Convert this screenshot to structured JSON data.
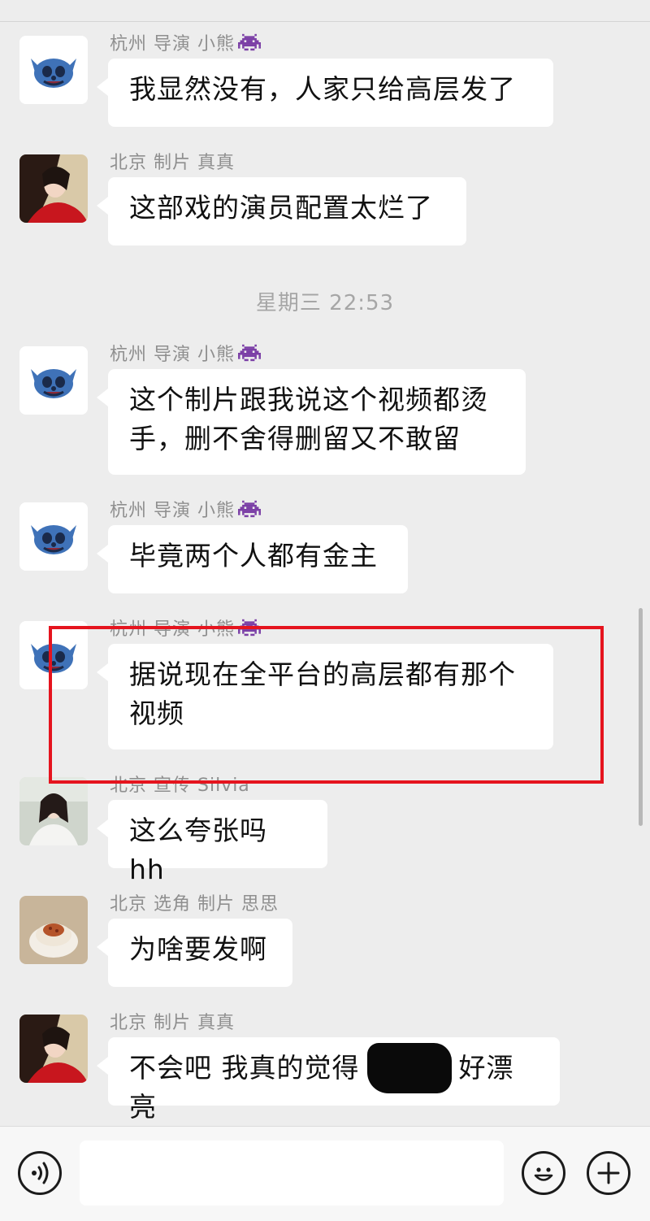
{
  "timestamp": "星期三 22:53",
  "messages": [
    {
      "sender": "杭州 导演 小熊",
      "emoji": "space-invader-icon",
      "text": "我显然没有，人家只给高层发了",
      "avatar": "stitch-avatar"
    },
    {
      "sender": "北京 制片 真真",
      "emoji": "",
      "text": "这部戏的演员配置太烂了",
      "avatar": "woman-red-dress-avatar"
    },
    {
      "sender": "杭州 导演 小熊",
      "emoji": "space-invader-icon",
      "text": "这个制片跟我说这个视频都烫手，删不舍得删留又不敢留",
      "avatar": "stitch-avatar"
    },
    {
      "sender": "杭州 导演 小熊",
      "emoji": "space-invader-icon",
      "text": "毕竟两个人都有金主",
      "avatar": "stitch-avatar"
    },
    {
      "sender": "杭州 导演 小熊",
      "emoji": "space-invader-icon",
      "text": "据说现在全平台的高层都有那个视频",
      "avatar": "stitch-avatar"
    },
    {
      "sender": "北京 宣传 Silvia",
      "emoji": "",
      "text": "这么夸张吗 hh",
      "avatar": "girl-photo-avatar"
    },
    {
      "sender": "北京 选角 制片 思思",
      "emoji": "",
      "text": "为啥要发啊",
      "avatar": "dessert-photo-avatar"
    },
    {
      "sender": "北京 制片 真真",
      "emoji": "",
      "text_before": "不会吧 我真的觉得",
      "text_after": "好漂亮",
      "avatar": "woman-red-dress-avatar"
    }
  ],
  "input": {
    "value": "",
    "placeholder": ""
  },
  "colors": {
    "background": "#ededed",
    "bubble": "#ffffff",
    "highlight": "#e5141e",
    "sender_text": "#8f8f8f"
  }
}
